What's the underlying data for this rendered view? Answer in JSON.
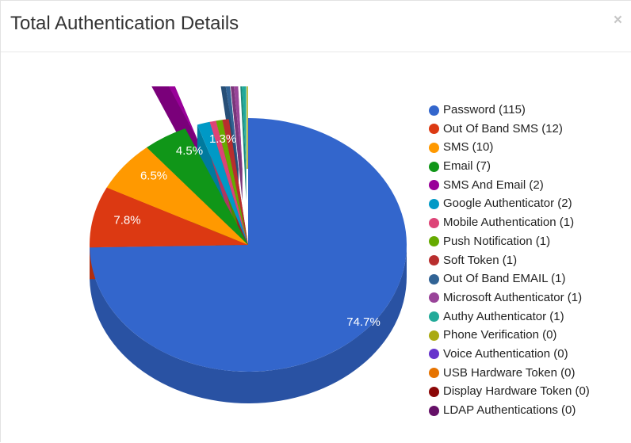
{
  "header": {
    "title": "Total Authentication Details",
    "close_label": "×"
  },
  "chart_data": {
    "type": "pie",
    "variant": "3d",
    "title": "Total Authentication Details",
    "categories": [
      "Password",
      "Out Of Band SMS",
      "SMS",
      "Email",
      "SMS And Email",
      "Google Authenticator",
      "Mobile Authentication",
      "Push Notification",
      "Soft Token",
      "Out Of Band EMAIL",
      "Microsoft Authenticator",
      "Authy Authenticator",
      "Phone Verification",
      "Voice Authentication",
      "USB Hardware Token",
      "Display Hardware Token",
      "LDAP Authentications"
    ],
    "values": [
      115,
      12,
      10,
      7,
      2,
      2,
      1,
      1,
      1,
      1,
      1,
      1,
      0,
      0,
      0,
      0,
      0
    ],
    "colors": [
      "#3366cc",
      "#dc3912",
      "#ff9900",
      "#109618",
      "#990099",
      "#0099c6",
      "#dd4477",
      "#66aa00",
      "#b82e2e",
      "#316395",
      "#994499",
      "#22aa99",
      "#aaaa11",
      "#6633cc",
      "#e67300",
      "#8b0707",
      "#651067"
    ],
    "data_labels": [
      {
        "category": "Password",
        "text": "74.7%"
      },
      {
        "category": "Out Of Band SMS",
        "text": "7.8%"
      },
      {
        "category": "SMS",
        "text": "6.5%"
      },
      {
        "category": "Email",
        "text": "4.5%"
      },
      {
        "category": "Google Authenticator",
        "text": "1.3%"
      }
    ],
    "legend": {
      "position": "right",
      "entries": [
        "Password (115)",
        "Out Of Band SMS (12)",
        "SMS (10)",
        "Email (7)",
        "SMS And Email (2)",
        "Google Authenticator (2)",
        "Mobile Authentication (1)",
        "Push Notification (1)",
        "Soft Token (1)",
        "Out Of Band EMAIL (1)",
        "Microsoft Authenticator (1)",
        "Authy Authenticator (1)",
        "Phone Verification (0)",
        "Voice Authentication (0)",
        "USB Hardware Token (0)",
        "Display Hardware Token (0)",
        "LDAP Authentications (0)"
      ]
    }
  }
}
